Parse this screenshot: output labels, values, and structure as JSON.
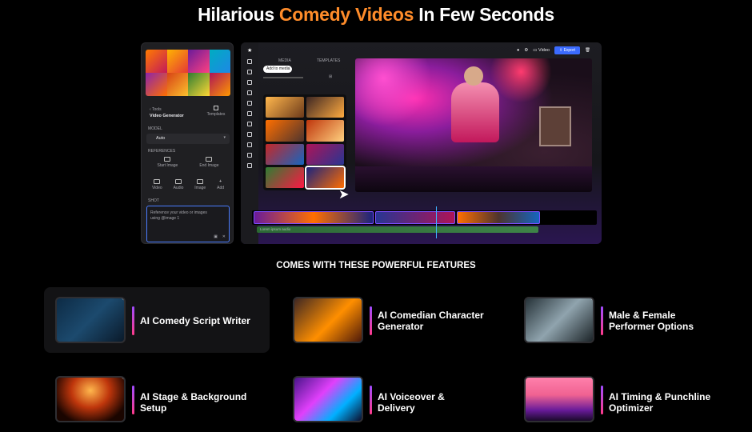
{
  "headline": {
    "part1": "Hilarious ",
    "accent": "Comedy Videos",
    "part2": " In Few Seconds",
    "accent_color": "#ff8c2a"
  },
  "generator": {
    "back_label": "Tools",
    "title": "Video Generator",
    "templates_label": "Templates",
    "model_heading": "MODEL",
    "model_value": "Auto",
    "references_heading": "REFERENCES",
    "start_image": "Start Image",
    "end_image": "End Image",
    "ref_items": [
      "Video",
      "Audio",
      "Image",
      "Add"
    ],
    "prompt_heading": "SHOT",
    "prompt_placeholder": "Reference your video or images using @image 1"
  },
  "editor": {
    "media_tab": "MEDIA",
    "templates_tab": "TEMPLATES",
    "add_media": "Add to media",
    "video_label": "Video",
    "export_label": "Export",
    "audio_track_label": "Lorem ipsum audio"
  },
  "section_title": "COMES WITH THESE  POWERFUL FEATURES",
  "features": [
    {
      "line1": "AI Comedy Script Writer",
      "line2": ""
    },
    {
      "line1": "AI Comedian Character",
      "line2": "Generator"
    },
    {
      "line1": "Male & Female",
      "line2": "Performer Options"
    },
    {
      "line1": "AI Stage & Background",
      "line2": "Setup"
    },
    {
      "line1": "AI Voiceover &",
      "line2": "Delivery"
    },
    {
      "line1": "AI Timing & Punchline",
      "line2": "Optimizer"
    }
  ],
  "colors": {
    "background": "#000000",
    "accent_orange": "#ff8c2a",
    "export_blue": "#3b6bff",
    "feature_bar_top": "#a04bff",
    "feature_bar_bottom": "#ff3b8a"
  }
}
